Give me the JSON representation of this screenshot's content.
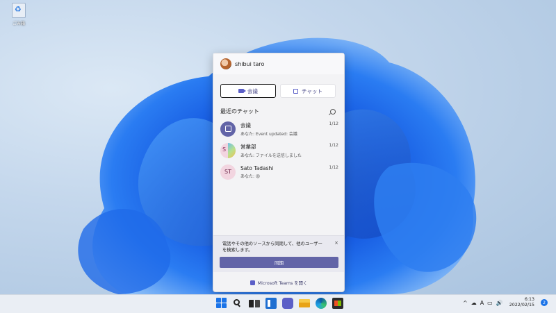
{
  "desktop": {
    "recycle_bin_label": "ごみ箱"
  },
  "flyout": {
    "user_name": "shibui taro",
    "meet_label": "会議",
    "chat_label": "チャット",
    "recent_title": "最近のチャット",
    "chats": [
      {
        "name": "会議",
        "preview": "あなた: Event updated: 会議",
        "date": "1/12",
        "avatar": "calendar-icon"
      },
      {
        "name": "営業部",
        "preview": "あなた: ファイルを送信しました",
        "date": "1/12",
        "avatar_initial": "S"
      },
      {
        "name": "Sato Tadashi",
        "preview": "あなた: 😡",
        "date": "1/12",
        "avatar_initials": "ST"
      }
    ],
    "notice_text": "電話やその他のソースから同期して、他のユーザーを検索します。",
    "notice_close": "×",
    "sync_label": "同期",
    "open_teams_label": "Microsoft Teams を開く"
  },
  "taskbar": {
    "clock_time": "6:13",
    "clock_date": "2022/02/15",
    "ime_indicator": "A",
    "notification_count": "2",
    "tray_chevron": "^"
  }
}
